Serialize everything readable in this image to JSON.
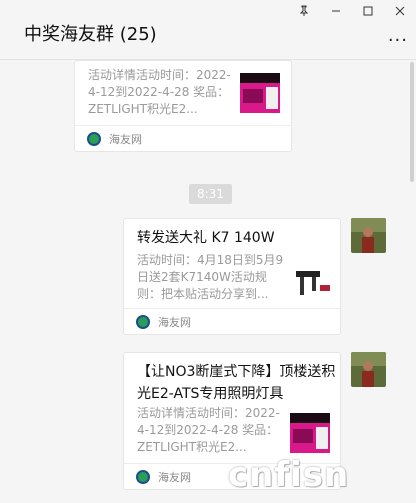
{
  "window": {
    "title": "中奖海友群 (25)",
    "controls": [
      "pin-icon",
      "minimize-icon",
      "maximize-icon",
      "close-icon"
    ],
    "more_icon": "···"
  },
  "messages": [
    {
      "title": "",
      "desc": "活动详情活动时间：2022-4-12到2022-4-28 奖品：ZETLIGHT积光E2...",
      "source": "海友网"
    },
    {
      "title": "转发送大礼 K7 140W",
      "desc": "活动时间：4月18日到5月9日送2套K7140W活动规则：把本贴活动分享到...",
      "source": "海友网"
    },
    {
      "title": "【让NO3断崖式下降】顶楼送积光E2-ATS专用照明灯具",
      "desc": "活动详情活动时间：2022-4-12到2022-4-28 奖品：ZETLIGHT积光E2...",
      "source": "海友网"
    }
  ],
  "time_divider": "8:31",
  "watermark": "cnfisn",
  "colors": {
    "brand": "#2a9d57",
    "thumb_pink": "#d9188a"
  }
}
